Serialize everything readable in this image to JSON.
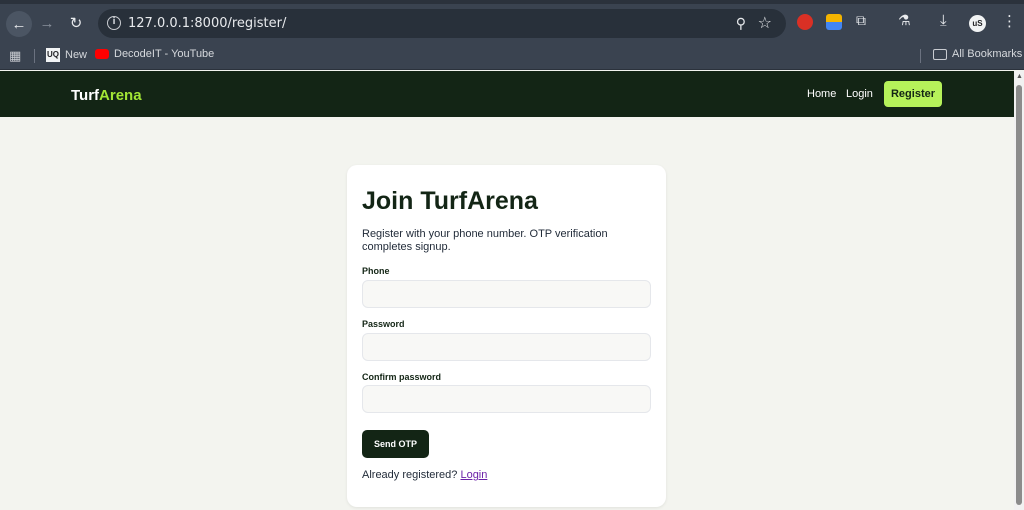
{
  "browser": {
    "url": "127.0.0.1:8000/register/",
    "bookmarks": [
      {
        "label": "New",
        "icon": "uq-favicon"
      },
      {
        "label": "DecodeIT - YouTube",
        "icon": "youtube-favicon"
      }
    ],
    "all_bookmarks": "All Bookmarks",
    "avatar_text": "uS"
  },
  "header": {
    "logo_main": "Turf",
    "logo_accent": "Arena",
    "nav": {
      "home": "Home",
      "login": "Login",
      "register": "Register"
    }
  },
  "form": {
    "title": "Join TurfArena",
    "description": "Register with your phone number. OTP verification completes signup.",
    "phone_label": "Phone",
    "phone_value": "",
    "password_label": "Password",
    "password_value": "",
    "confirm_label": "Confirm password",
    "confirm_value": "",
    "submit_label": "Send OTP",
    "footer_text": "Already registered?",
    "footer_link": "Login"
  },
  "colors": {
    "header_bg": "#132515",
    "accent": "#a3e635",
    "register_btn": "#b6f25a",
    "page_bg": "#f3f4ef"
  }
}
